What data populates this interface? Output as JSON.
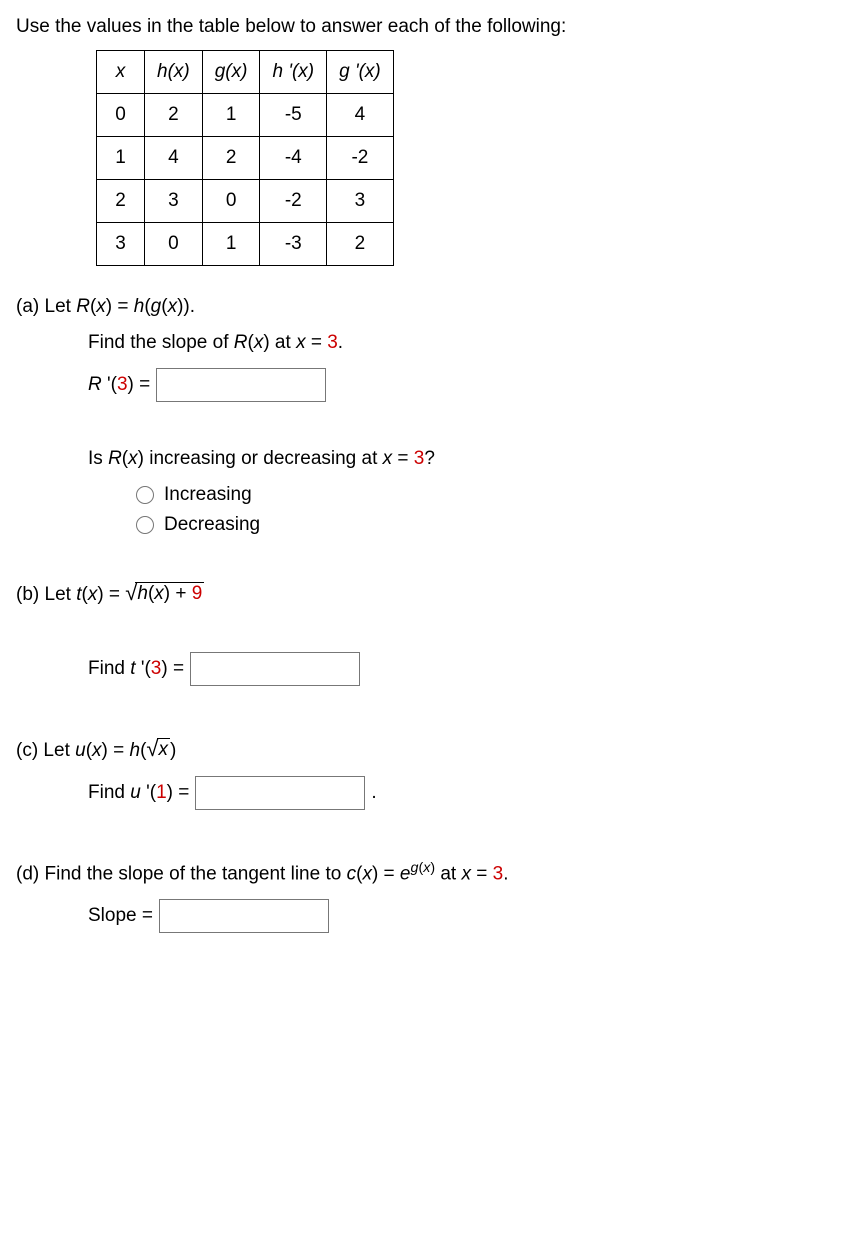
{
  "prompt": "Use the values in the table below to answer each of the following:",
  "table": {
    "headers": [
      "x",
      "h(x)",
      "g(x)",
      "h '(x)",
      "g '(x)"
    ],
    "rows": [
      [
        "0",
        "2",
        "1",
        "-5",
        "4"
      ],
      [
        "1",
        "4",
        "2",
        "-4",
        "-2"
      ],
      [
        "2",
        "3",
        "0",
        "-2",
        "3"
      ],
      [
        "3",
        "0",
        "1",
        "-3",
        "2"
      ]
    ]
  },
  "a": {
    "label": "(a) Let ",
    "def1": "R",
    "def2": "(",
    "def3": "x",
    "def4": ") = ",
    "def5": "h",
    "def6": "(",
    "def7": "g",
    "def8": "(",
    "def9": "x",
    "def10": ")).",
    "find_pre": "Find the slope of ",
    "find_r": "R",
    "find_paren": "(",
    "find_x": "x",
    "find_post": ") at ",
    "find_xeq": "x",
    "find_eq": " = ",
    "find_val": "3",
    "find_dot": ".",
    "ans_lhs1": "R ",
    "ans_lhs2": "'(",
    "ans_lhs3": "3",
    "ans_lhs4": ") = ",
    "q2_pre": "Is ",
    "q2_r": "R",
    "q2_p1": "(",
    "q2_x": "x",
    "q2_p2": ") increasing or decreasing at ",
    "q2_xeq": "x",
    "q2_eq": " = ",
    "q2_val": "3",
    "q2_qm": "?",
    "opt1": "Increasing",
    "opt2": "Decreasing"
  },
  "b": {
    "label": "(b) Let  ",
    "t": "t",
    "p1": "(",
    "x": "x",
    "p2": ") = ",
    "inside_h": "h",
    "inside_p1": "(",
    "inside_x": "x",
    "inside_p2": ") + ",
    "inside_9": "9",
    "find_pre": "Find ",
    "find_t": "t ",
    "find_tick": "'(",
    "find_3": "3",
    "find_post": ") = "
  },
  "c": {
    "label": "(c) Let  ",
    "u": "u",
    "p1": "(",
    "x": "x",
    "p2": ") = ",
    "h": "h",
    "hp1": "(",
    "sqx": "x",
    "hp2": ")",
    "find_pre": "Find ",
    "find_u": "u ",
    "find_tick": "'(",
    "find_1": "1",
    "find_post": ") = ",
    "period": " ."
  },
  "d": {
    "label": "(d) Find the slope of the tangent line to  ",
    "c": "c",
    "p1": "(",
    "x": "x",
    "p2": ") = ",
    "e": "e",
    "sup_g": "g",
    "sup_p1": "(",
    "sup_x": "x",
    "sup_p2": ")",
    "at": "  at ",
    "xeq": "x",
    "eq": " = ",
    "val": "3",
    "dot": ".",
    "slope": "Slope = "
  }
}
